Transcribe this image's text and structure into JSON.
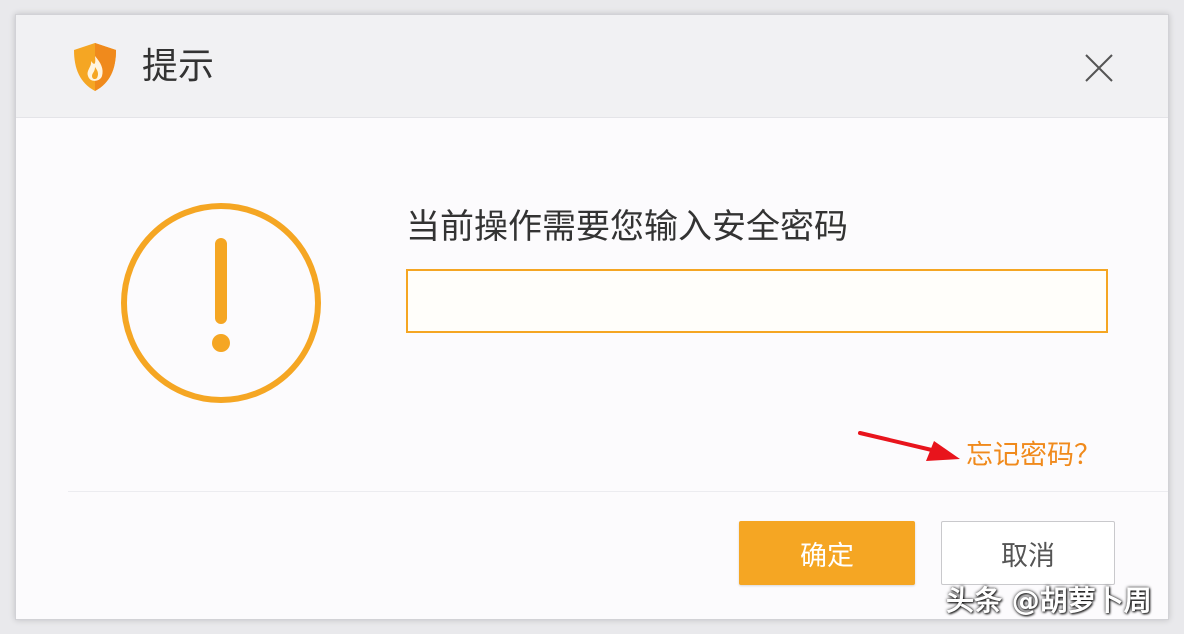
{
  "dialog": {
    "title": "提示",
    "icons": {
      "app": "flame-shield-icon",
      "close": "close-icon",
      "warning": "warning-circle-icon",
      "annotation": "red-arrow-icon"
    },
    "prompt": "当前操作需要您输入安全密码",
    "password_input": {
      "value": "",
      "placeholder": ""
    },
    "forgot_password": "忘记密码？",
    "buttons": {
      "ok": "确定",
      "cancel": "取消"
    }
  },
  "watermark": "头条 @胡萝卜周",
  "colors": {
    "accent": "#f5a623",
    "link": "#f08a1c",
    "annotation_arrow": "#e8141c",
    "title_bar": "#f1f1f3",
    "background": "#fcfbfd"
  }
}
